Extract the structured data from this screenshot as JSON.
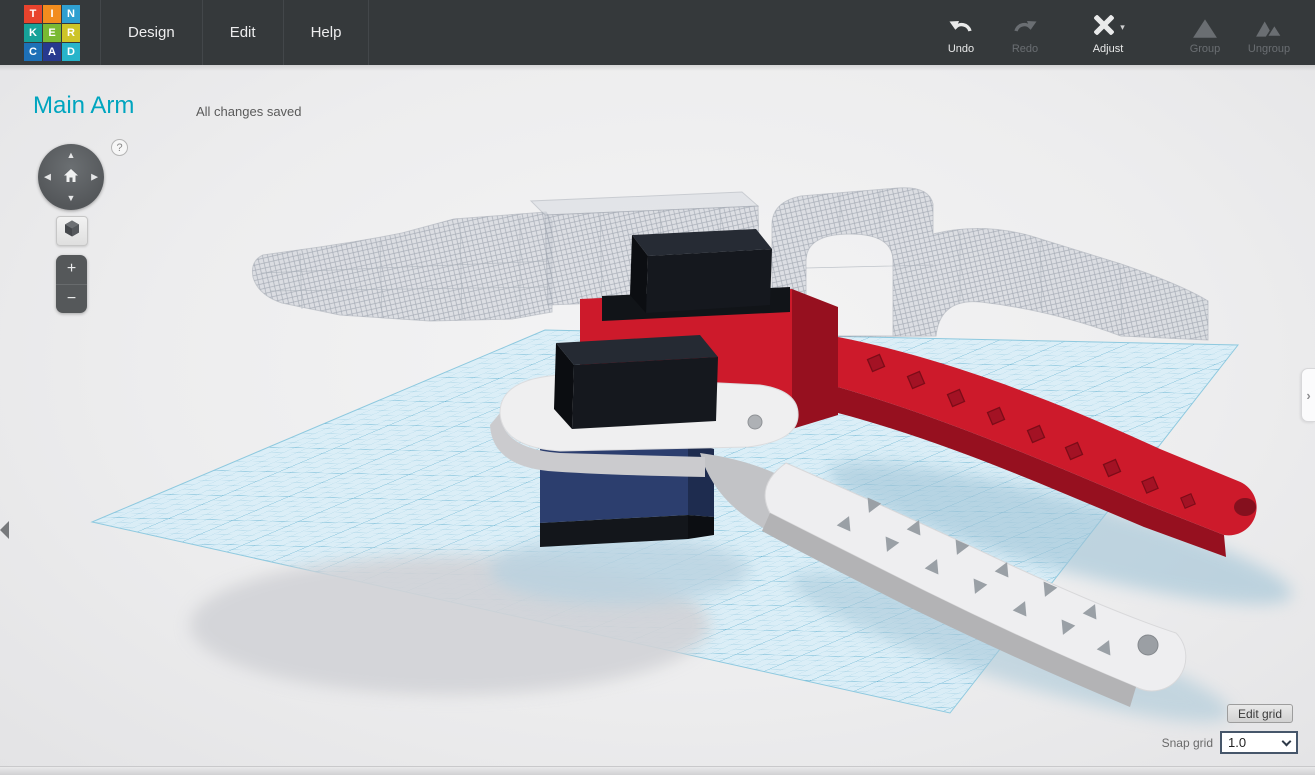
{
  "app": {
    "title": "Tinkercad"
  },
  "logo": {
    "letters": [
      {
        "ch": "T",
        "bg": "#e8432d"
      },
      {
        "ch": "I",
        "bg": "#f28c1e"
      },
      {
        "ch": "N",
        "bg": "#2f9fd0"
      },
      {
        "ch": "K",
        "bg": "#16a298"
      },
      {
        "ch": "E",
        "bg": "#79b933"
      },
      {
        "ch": "R",
        "bg": "#cdc428"
      },
      {
        "ch": "C",
        "bg": "#1d70b7"
      },
      {
        "ch": "A",
        "bg": "#27398f"
      },
      {
        "ch": "D",
        "bg": "#28b4ca"
      }
    ]
  },
  "menu": {
    "items": [
      {
        "label": "Design"
      },
      {
        "label": "Edit"
      },
      {
        "label": "Help"
      }
    ]
  },
  "toolbar": {
    "buttons": [
      {
        "label": "Undo",
        "enabled": true
      },
      {
        "label": "Redo",
        "enabled": false
      },
      {
        "label": "Adjust",
        "enabled": true,
        "dropdown": true
      },
      {
        "label": "Group",
        "enabled": false
      },
      {
        "label": "Ungroup",
        "enabled": false
      }
    ]
  },
  "header": {
    "title": "Main Arm",
    "status": "All changes saved"
  },
  "icons": {
    "dropdown_caret": "▾",
    "help": "?",
    "orbit_up": "▲",
    "orbit_down": "▼",
    "orbit_left": "◀",
    "orbit_right": "▶",
    "zoom_in": "+",
    "zoom_out": "−",
    "panel_toggle": "›"
  },
  "grid_controls": {
    "edit_grid_label": "Edit grid",
    "snap_label": "Snap grid",
    "snap_value": "1.0"
  },
  "colors": {
    "accent": "#00a5bf",
    "topbar_bg": "#35393b",
    "plane_fill": "#d8edf7",
    "grid_fine": "#8fc8de",
    "grid_coarse": "#62b1d0",
    "red_top": "#cd1a2b",
    "red_side": "#96101f",
    "white_top": "#efeff0",
    "white_side": "#b3b3b5",
    "black_part": "#15181e",
    "blue_servo": "#2c3e6e",
    "ghost_gray": "#ccd0d8"
  },
  "scene": {
    "workplane": {
      "kind": "workplane"
    },
    "objects": [
      {
        "name": "red-arm",
        "color": "#cd1a2b"
      },
      {
        "name": "white-arm",
        "color": "#efeff0"
      },
      {
        "name": "black-box-upper",
        "color": "#15181e"
      },
      {
        "name": "black-box-lower",
        "color": "#15181e"
      },
      {
        "name": "blue-servo",
        "color": "#2c3e6e"
      },
      {
        "name": "hole-arm-left",
        "color": "#ccd0d8"
      },
      {
        "name": "hole-block-center",
        "color": "#ccd0d8"
      },
      {
        "name": "hole-arch-right",
        "color": "#ccd0d8"
      }
    ]
  }
}
